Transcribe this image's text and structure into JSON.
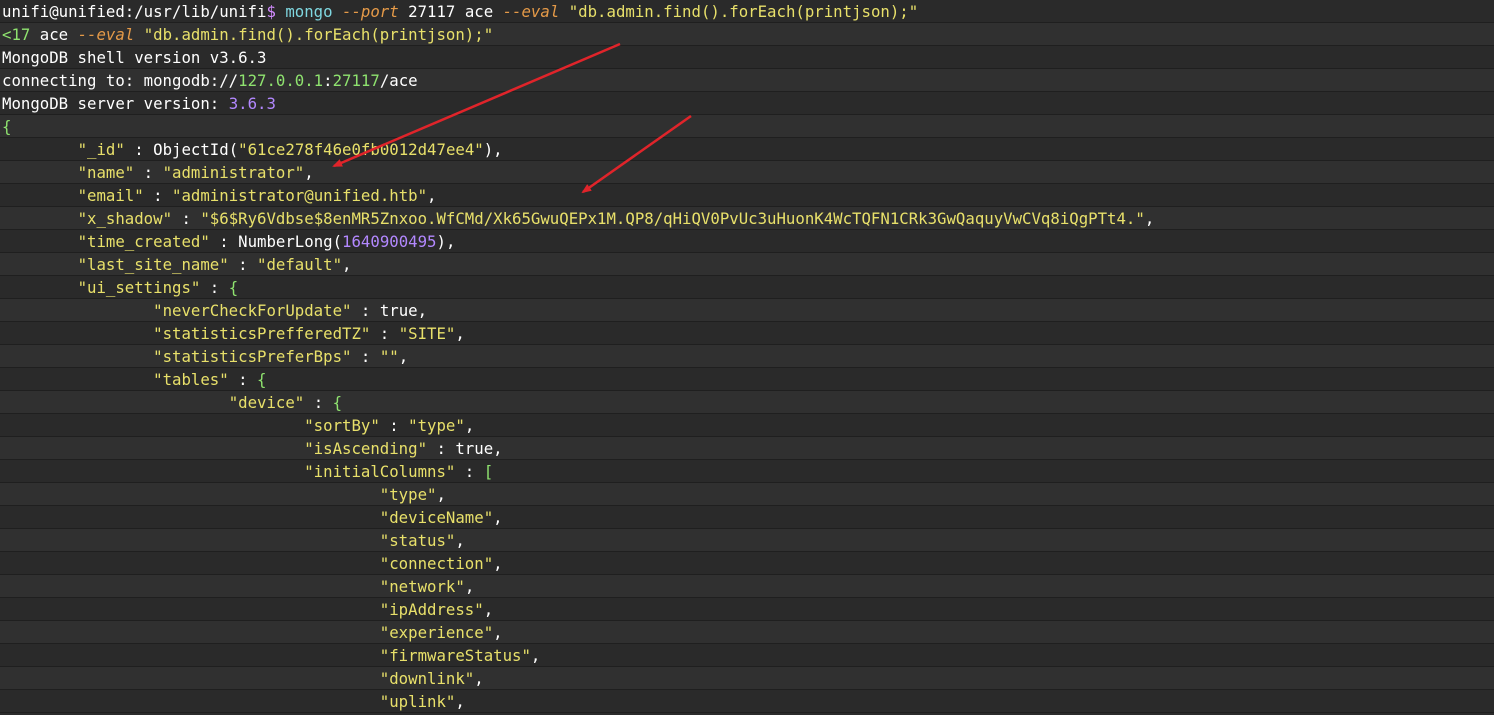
{
  "terminal": {
    "lines": [
      [
        {
          "t": "unifi@unified:/usr/lib/unifi",
          "c": "c-white"
        },
        {
          "t": "$ ",
          "c": "c-purple"
        },
        {
          "t": "mongo ",
          "c": "c-cyan"
        },
        {
          "t": "--port ",
          "c": "c-orange"
        },
        {
          "t": "27117 ",
          "c": "c-white"
        },
        {
          "t": "ace ",
          "c": "c-white"
        },
        {
          "t": "--eval ",
          "c": "c-orange"
        },
        {
          "t": "\"db.admin.find().forEach(printjson);\"",
          "c": "c-yellow"
        }
      ],
      [
        {
          "t": "<17 ",
          "c": "c-green"
        },
        {
          "t": "ace ",
          "c": "c-white"
        },
        {
          "t": "--eval ",
          "c": "c-orange"
        },
        {
          "t": "\"db.admin.find().forEach(printjson);\"",
          "c": "c-yellow"
        }
      ],
      [
        {
          "t": "MongoDB shell version v3.6.3",
          "c": "c-white"
        }
      ],
      [
        {
          "t": "connecting to: mongodb://",
          "c": "c-white"
        },
        {
          "t": "127.0.0.1",
          "c": "c-green"
        },
        {
          "t": ":",
          "c": "c-white"
        },
        {
          "t": "27117",
          "c": "c-green"
        },
        {
          "t": "/ace",
          "c": "c-white"
        }
      ],
      [
        {
          "t": "MongoDB server version: ",
          "c": "c-white"
        },
        {
          "t": "3.6.3",
          "c": "c-number"
        }
      ],
      [
        {
          "t": "{",
          "c": "c-green"
        }
      ],
      [
        {
          "t": "        ",
          "c": "c-white"
        },
        {
          "t": "\"_id\"",
          "c": "c-yellow"
        },
        {
          "t": " : ",
          "c": "c-white"
        },
        {
          "t": "ObjectId(",
          "c": "c-white"
        },
        {
          "t": "\"61ce278f46e0fb0012d47ee4\"",
          "c": "c-yellow"
        },
        {
          "t": "),",
          "c": "c-white"
        }
      ],
      [
        {
          "t": "        ",
          "c": "c-white"
        },
        {
          "t": "\"name\"",
          "c": "c-yellow"
        },
        {
          "t": " : ",
          "c": "c-white"
        },
        {
          "t": "\"administrator\"",
          "c": "c-yellow"
        },
        {
          "t": ",",
          "c": "c-white"
        }
      ],
      [
        {
          "t": "        ",
          "c": "c-white"
        },
        {
          "t": "\"email\"",
          "c": "c-yellow"
        },
        {
          "t": " : ",
          "c": "c-white"
        },
        {
          "t": "\"administrator@unified.htb\"",
          "c": "c-yellow"
        },
        {
          "t": ",",
          "c": "c-white"
        }
      ],
      [
        {
          "t": "        ",
          "c": "c-white"
        },
        {
          "t": "\"x_shadow\"",
          "c": "c-yellow"
        },
        {
          "t": " : ",
          "c": "c-white"
        },
        {
          "t": "\"$6$Ry6Vdbse$8enMR5Znxoo.WfCMd/Xk65GwuQEPx1M.QP8/qHiQV0PvUc3uHuonK4WcTQFN1CRk3GwQaquyVwCVq8iQgPTt4.\"",
          "c": "c-yellow"
        },
        {
          "t": ",",
          "c": "c-white"
        }
      ],
      [
        {
          "t": "        ",
          "c": "c-white"
        },
        {
          "t": "\"time_created\"",
          "c": "c-yellow"
        },
        {
          "t": " : ",
          "c": "c-white"
        },
        {
          "t": "NumberLong(",
          "c": "c-white"
        },
        {
          "t": "1640900495",
          "c": "c-number"
        },
        {
          "t": "),",
          "c": "c-white"
        }
      ],
      [
        {
          "t": "        ",
          "c": "c-white"
        },
        {
          "t": "\"last_site_name\"",
          "c": "c-yellow"
        },
        {
          "t": " : ",
          "c": "c-white"
        },
        {
          "t": "\"default\"",
          "c": "c-yellow"
        },
        {
          "t": ",",
          "c": "c-white"
        }
      ],
      [
        {
          "t": "        ",
          "c": "c-white"
        },
        {
          "t": "\"ui_settings\"",
          "c": "c-yellow"
        },
        {
          "t": " : ",
          "c": "c-white"
        },
        {
          "t": "{",
          "c": "c-green"
        }
      ],
      [
        {
          "t": "                ",
          "c": "c-white"
        },
        {
          "t": "\"neverCheckForUpdate\"",
          "c": "c-yellow"
        },
        {
          "t": " : ",
          "c": "c-white"
        },
        {
          "t": "true",
          "c": "c-white"
        },
        {
          "t": ",",
          "c": "c-white"
        }
      ],
      [
        {
          "t": "                ",
          "c": "c-white"
        },
        {
          "t": "\"statisticsPrefferedTZ\"",
          "c": "c-yellow"
        },
        {
          "t": " : ",
          "c": "c-white"
        },
        {
          "t": "\"SITE\"",
          "c": "c-yellow"
        },
        {
          "t": ",",
          "c": "c-white"
        }
      ],
      [
        {
          "t": "                ",
          "c": "c-white"
        },
        {
          "t": "\"statisticsPreferBps\"",
          "c": "c-yellow"
        },
        {
          "t": " : ",
          "c": "c-white"
        },
        {
          "t": "\"\"",
          "c": "c-yellow"
        },
        {
          "t": ",",
          "c": "c-white"
        }
      ],
      [
        {
          "t": "                ",
          "c": "c-white"
        },
        {
          "t": "\"tables\"",
          "c": "c-yellow"
        },
        {
          "t": " : ",
          "c": "c-white"
        },
        {
          "t": "{",
          "c": "c-green"
        }
      ],
      [
        {
          "t": "                        ",
          "c": "c-white"
        },
        {
          "t": "\"device\"",
          "c": "c-yellow"
        },
        {
          "t": " : ",
          "c": "c-white"
        },
        {
          "t": "{",
          "c": "c-green"
        }
      ],
      [
        {
          "t": "                                ",
          "c": "c-white"
        },
        {
          "t": "\"sortBy\"",
          "c": "c-yellow"
        },
        {
          "t": " : ",
          "c": "c-white"
        },
        {
          "t": "\"type\"",
          "c": "c-yellow"
        },
        {
          "t": ",",
          "c": "c-white"
        }
      ],
      [
        {
          "t": "                                ",
          "c": "c-white"
        },
        {
          "t": "\"isAscending\"",
          "c": "c-yellow"
        },
        {
          "t": " : ",
          "c": "c-white"
        },
        {
          "t": "true",
          "c": "c-white"
        },
        {
          "t": ",",
          "c": "c-white"
        }
      ],
      [
        {
          "t": "                                ",
          "c": "c-white"
        },
        {
          "t": "\"initialColumns\"",
          "c": "c-yellow"
        },
        {
          "t": " : ",
          "c": "c-white"
        },
        {
          "t": "[",
          "c": "c-green"
        }
      ],
      [
        {
          "t": "                                        ",
          "c": "c-white"
        },
        {
          "t": "\"type\"",
          "c": "c-yellow"
        },
        {
          "t": ",",
          "c": "c-white"
        }
      ],
      [
        {
          "t": "                                        ",
          "c": "c-white"
        },
        {
          "t": "\"deviceName\"",
          "c": "c-yellow"
        },
        {
          "t": ",",
          "c": "c-white"
        }
      ],
      [
        {
          "t": "                                        ",
          "c": "c-white"
        },
        {
          "t": "\"status\"",
          "c": "c-yellow"
        },
        {
          "t": ",",
          "c": "c-white"
        }
      ],
      [
        {
          "t": "                                        ",
          "c": "c-white"
        },
        {
          "t": "\"connection\"",
          "c": "c-yellow"
        },
        {
          "t": ",",
          "c": "c-white"
        }
      ],
      [
        {
          "t": "                                        ",
          "c": "c-white"
        },
        {
          "t": "\"network\"",
          "c": "c-yellow"
        },
        {
          "t": ",",
          "c": "c-white"
        }
      ],
      [
        {
          "t": "                                        ",
          "c": "c-white"
        },
        {
          "t": "\"ipAddress\"",
          "c": "c-yellow"
        },
        {
          "t": ",",
          "c": "c-white"
        }
      ],
      [
        {
          "t": "                                        ",
          "c": "c-white"
        },
        {
          "t": "\"experience\"",
          "c": "c-yellow"
        },
        {
          "t": ",",
          "c": "c-white"
        }
      ],
      [
        {
          "t": "                                        ",
          "c": "c-white"
        },
        {
          "t": "\"firmwareStatus\"",
          "c": "c-yellow"
        },
        {
          "t": ",",
          "c": "c-white"
        }
      ],
      [
        {
          "t": "                                        ",
          "c": "c-white"
        },
        {
          "t": "\"downlink\"",
          "c": "c-yellow"
        },
        {
          "t": ",",
          "c": "c-white"
        }
      ],
      [
        {
          "t": "                                        ",
          "c": "c-white"
        },
        {
          "t": "\"uplink\"",
          "c": "c-yellow"
        },
        {
          "t": ",",
          "c": "c-white"
        }
      ]
    ]
  },
  "annotations": {
    "arrow_color": "#e0242a"
  }
}
